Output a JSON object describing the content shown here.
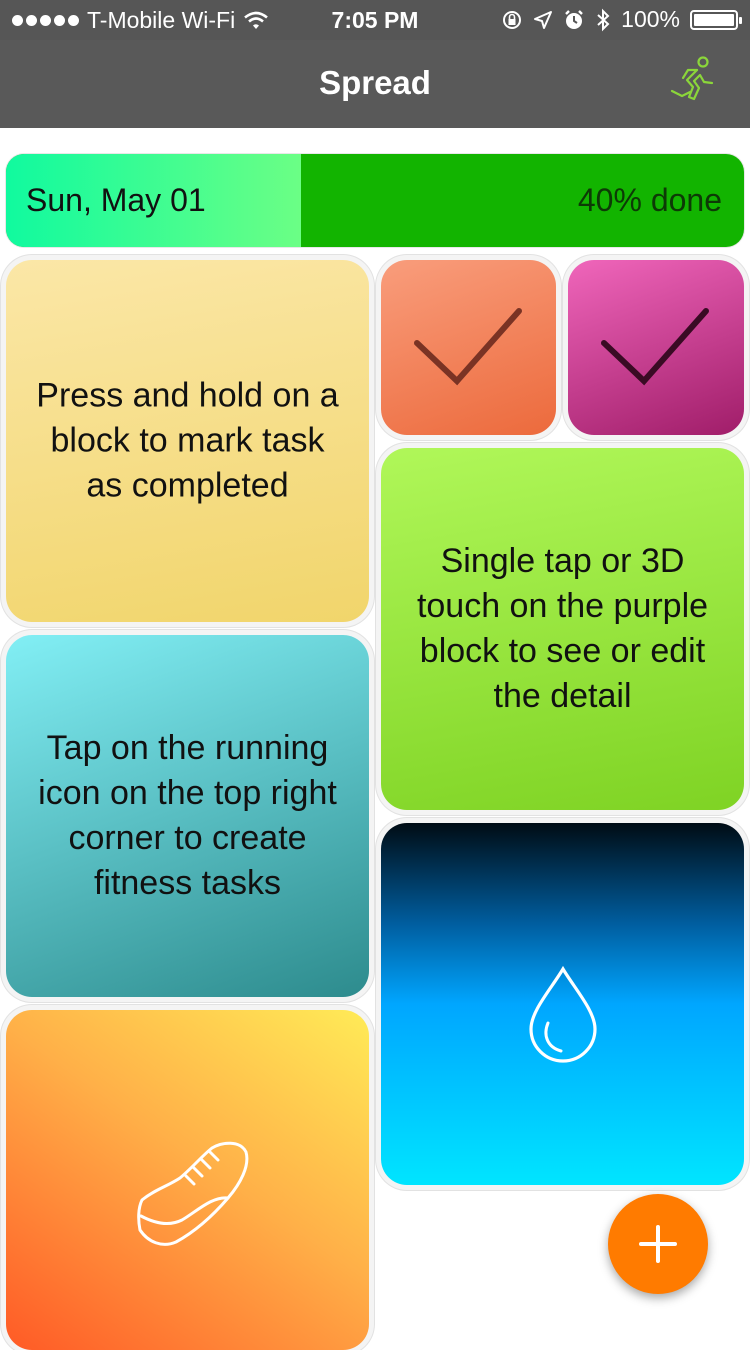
{
  "status_bar": {
    "carrier": "T-Mobile Wi-Fi",
    "time": "7:05 PM",
    "battery": "100%",
    "icons": [
      "signal-dots-icon",
      "wifi-icon",
      "orientation-lock-icon",
      "location-icon",
      "alarm-icon",
      "bluetooth-icon",
      "battery-icon"
    ]
  },
  "nav": {
    "title": "Spread",
    "right_icon": "running-man-icon",
    "right_icon_color": "#8bd63a"
  },
  "progress": {
    "date": "Sun, May 01",
    "label": "40% done",
    "fraction": 0.4,
    "done_color": "#12b400"
  },
  "blocks": {
    "hold_tip": "Press and hold on a block to mark task as completed",
    "tap_tip": "Single tap or 3D touch on the purple block to see or edit the detail",
    "running_tip": "Tap on the running icon on the top right corner to create fitness tasks",
    "orange_block_icon": "check-icon",
    "purple_block_icon": "check-icon",
    "water_block_icon": "water-drop-icon",
    "shoe_block_icon": "sneaker-icon"
  },
  "fab": {
    "icon": "plus-icon",
    "color": "#ff7b00"
  }
}
